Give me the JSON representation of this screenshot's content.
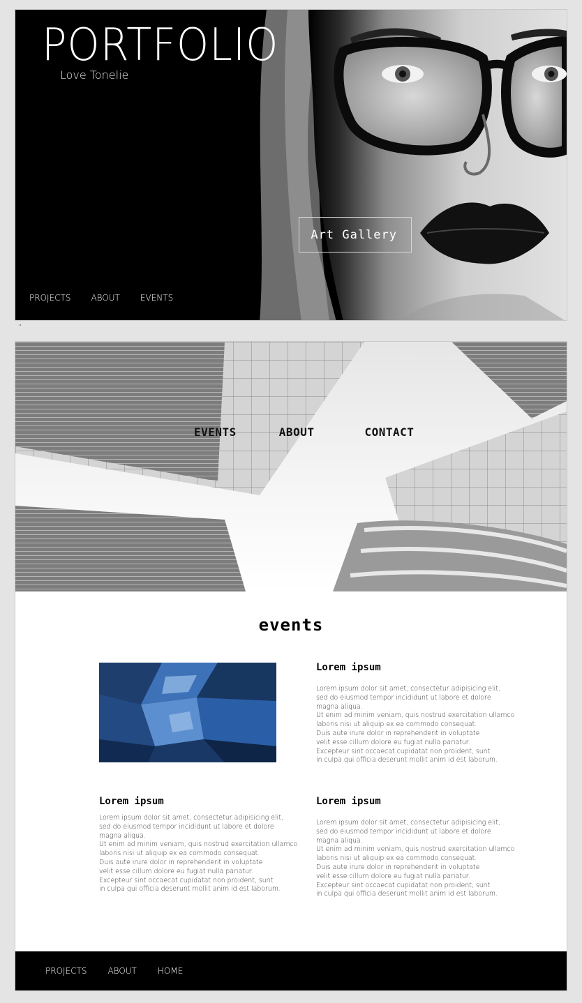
{
  "hero": {
    "title": "PORTFOLIO",
    "subtitle": "Love Tonelie",
    "button_label": "Art Gallery",
    "nav": [
      "PROJECTS",
      "ABOUT",
      "EVENTS"
    ]
  },
  "city_nav": [
    "EVENTS",
    "ABOUT",
    "CONTACT"
  ],
  "events": {
    "heading": "events",
    "blocks": [
      {
        "title": "Lorem ipsum",
        "body": "Lorem ipsum dolor sit amet, consectetur adipisicing elit,\nsed do eiusmod tempor incididunt ut labore et dolore\nmagna aliqua.\nUt enim ad minim veniam, quis nostrud exercitation ullamco\nlaboris nisi ut aliquip ex ea commodo consequat.\nDuis aute irure dolor in reprehenderit in voluptate\nvelit esse cillum dolore eu fugiat nulla pariatur.\nExcepteur sint occaecat cupidatat non proident, sunt\nin culpa qui officia deserunt mollit anim id est laborum."
      },
      {
        "title": "Lorem ipsum",
        "body": "Lorem ipsum dolor sit amet, consectetur adipisicing elit,\nsed do eiusmod tempor incididunt ut labore et dolore\nmagna aliqua.\nUt enim ad minim veniam, quis nostrud exercitation ullamco\nlaboris nisi ut aliquip ex ea commodo consequat.\nDuis aute irure dolor in reprehenderit in voluptate\nvelit esse cillum dolore eu fugiat nulla pariatur.\nExcepteur sint occaecat cupidatat non proident, sunt\nin culpa qui officia deserunt mollit anim id est laborum."
      },
      {
        "title": "Lorem ipsum",
        "body": "Lorem ipsum dolor sit amet, consectetur adipisicing elit,\nsed do eiusmod tempor incididunt ut labore et dolore\nmagna aliqua.\nUt enim ad minim veniam, quis nostrud exercitation ullamco\nlaboris nisi ut aliquip ex ea commodo consequat.\nDuis aute irure dolor in reprehenderit in voluptate\nvelit esse cillum dolore eu fugiat nulla pariatur.\nExcepteur sint occaecat cupidatat non proident, sunt\nin culpa qui officia deserunt mollit anim id est laborum."
      }
    ]
  },
  "footer": {
    "nav": [
      "PROJECTS",
      "ABOUT",
      "HOME"
    ]
  },
  "colors": {
    "hero_background": "#000000",
    "page_background": "#e4e4e4",
    "text_primary": "#000000",
    "crystal_blue": "#2a5fa8"
  }
}
